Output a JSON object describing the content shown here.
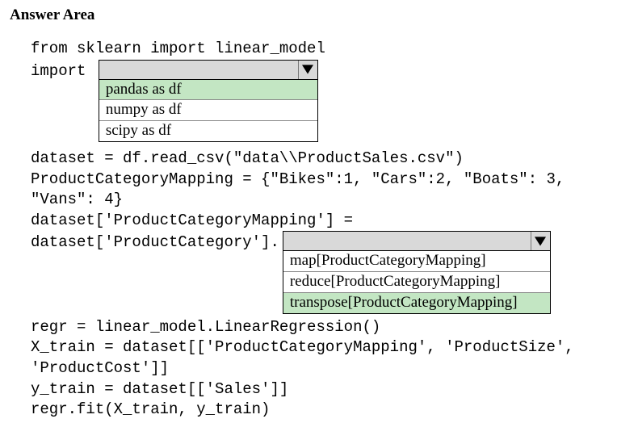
{
  "title": "Answer Area",
  "code": {
    "line1": "from sklearn import linear_model",
    "line2_prefix": "import ",
    "line3": "dataset = df.read_csv(\"data\\\\ProductSales.csv\")",
    "line4": "ProductCategoryMapping = {\"Bikes\":1, \"Cars\":2, \"Boats\": 3,",
    "line5": "\"Vans\": 4}",
    "line6": "dataset['ProductCategoryMapping'] =",
    "line7_prefix": "dataset['ProductCategory'].",
    "line8": "regr = linear_model.LinearRegression()",
    "line9": "X_train = dataset[['ProductCategoryMapping', 'ProductSize',",
    "line10": "'ProductCost']]",
    "line11": "y_train = dataset[['Sales']]",
    "line12": "regr.fit(X_train, y_train)"
  },
  "dropdown1": {
    "options": [
      {
        "label": "pandas as df",
        "selected": true
      },
      {
        "label": "numpy as df",
        "selected": false
      },
      {
        "label": "scipy as df",
        "selected": false
      }
    ]
  },
  "dropdown2": {
    "options": [
      {
        "label": "map[ProductCategoryMapping]",
        "selected": false
      },
      {
        "label": "reduce[ProductCategoryMapping]",
        "selected": false
      },
      {
        "label": "transpose[ProductCategoryMapping]",
        "selected": true
      }
    ]
  }
}
